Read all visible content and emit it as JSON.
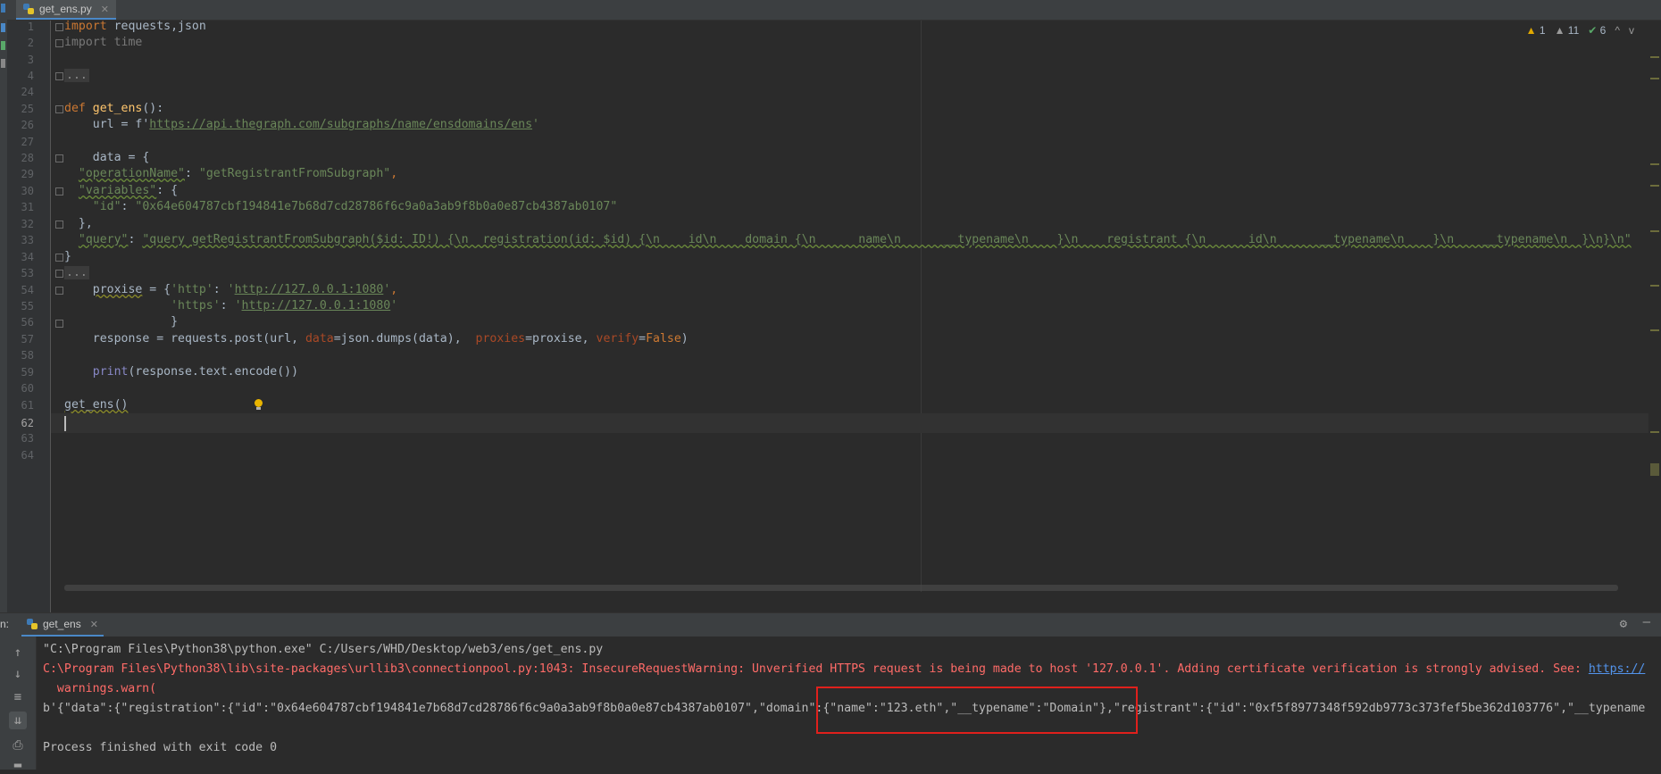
{
  "editor_tab": {
    "filename": "get_ens.py",
    "close_glyph": "✕"
  },
  "inspections": {
    "warnings": "1",
    "weak_warnings": "11",
    "typos": "6",
    "up": "^",
    "down": "v"
  },
  "line_numbers": [
    "1",
    "2",
    "3",
    "4",
    "24",
    "25",
    "26",
    "27",
    "28",
    "29",
    "30",
    "31",
    "32",
    "33",
    "34",
    "53",
    "54",
    "55",
    "56",
    "57",
    "58",
    "59",
    "60",
    "61",
    "62",
    "63",
    "64"
  ],
  "code": {
    "l1_import": "import",
    "l1_rest": " requests,json",
    "l2": "import time",
    "ellipsis": "...",
    "l25_def": "def",
    "l25_name": "get_ens",
    "l25_rest": "():",
    "l26_pre": "    url = f'",
    "l26_url": "https://api.thegraph.com/subgraphs/name/ensdomains/ens",
    "l26_post": "'",
    "l28": "    data = {",
    "l29_key": "\"operationName\"",
    "l29_mid": ": ",
    "l29_val": "\"getRegistrantFromSubgraph\"",
    "l29_end": ",",
    "l30_key": "\"variables\"",
    "l30_rest": ": {",
    "l31_key": "\"id\"",
    "l31_mid": ": ",
    "l31_val": "\"0x64e604787cbf194841e7b68d7cd28786f6c9a0a3ab9f8b0a0e87cb4387ab0107\"",
    "l32": "  },",
    "l33_key": "\"query\"",
    "l33_mid": ": ",
    "l33_val": "\"query getRegistrantFromSubgraph($id: ID!) {\\n  registration(id: $id) {\\n    id\\n    domain {\\n      name\\n      __typename\\n    }\\n    registrant {\\n      id\\n      __typename\\n    }\\n    __typename\\n  }\\n}\\n\"",
    "l34": "}",
    "l54_pre": "    ",
    "l54_var": "proxise",
    "l54_mid": " = {",
    "l54_k": "'http'",
    "l54_colon": ": ",
    "l54_q1": "'",
    "l54_url": "http://127.0.0.1:1080",
    "l54_q2": "'",
    "l54_end": ",",
    "l55_pre": "               ",
    "l55_k": "'https'",
    "l55_colon": ": ",
    "l55_q1": "'",
    "l55_url": "http://127.0.0.1:1080",
    "l55_q2": "'",
    "l56": "               }",
    "l57_a": "    response = requests.post(url, ",
    "l57_k1": "data",
    "l57_b": "=json.dumps(data),  ",
    "l57_k2": "proxies",
    "l57_c": "=proxise, ",
    "l57_k3": "verify",
    "l57_d": "=",
    "l57_false": "False",
    "l57_e": ")",
    "l59_pre": "    ",
    "l59_print": "print",
    "l59_rest": "(response.text.encode())",
    "l61": "get_ens()"
  },
  "run_panel": {
    "side_label": "n:",
    "tab_label": "get_ens",
    "close_glyph": "✕",
    "line1": "\"C:\\Program Files\\Python38\\python.exe\" C:/Users/WHD/Desktop/web3/ens/get_ens.py",
    "line2_text": "C:\\Program Files\\Python38\\lib\\site-packages\\urllib3\\connectionpool.py:1043: InsecureRequestWarning: Unverified HTTPS request is being made to host '127.0.0.1'. Adding certificate verification is strongly advised. See: ",
    "line2_link": "https://",
    "line3": "  warnings.warn(",
    "line4": "b'{\"data\":{\"registration\":{\"id\":\"0x64e604787cbf194841e7b68d7cd28786f6c9a0a3ab9f8b0a0e87cb4387ab0107\",\"domain\":{\"name\":\"123.eth\",\"__typename\":\"Domain\"},\"registrant\":{\"id\":\"0xf5f8977348f592db9773c373fef5be362d103776\",\"__typename",
    "line6": "Process finished with exit code 0"
  }
}
